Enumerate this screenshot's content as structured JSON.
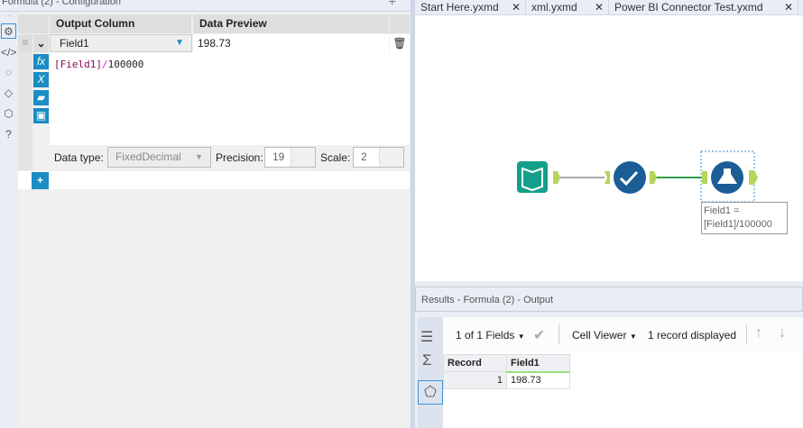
{
  "config": {
    "title": "Formula (2) - Configuration",
    "headers": {
      "output_column": "Output Column",
      "data_preview": "Data Preview"
    },
    "row": {
      "field": "Field1",
      "preview": "198.73"
    },
    "expression": {
      "bracket_open": "[",
      "field": "Field1",
      "bracket_close": "]",
      "op": "/",
      "number": "100000"
    },
    "data_type_label": "Data type:",
    "data_type": "FixedDecimal",
    "precision_label": "Precision:",
    "precision": "19",
    "scale_label": "Scale:",
    "scale": "2"
  },
  "tabs": [
    {
      "label": "Start Here.yxmd"
    },
    {
      "label": "xml.yxmd"
    },
    {
      "label": "Power BI Connector Test.yxmd"
    }
  ],
  "canvas": {
    "annotation_line1": "Field1 =",
    "annotation_line2": "[Field1]/100000"
  },
  "results": {
    "title": "Results - Formula (2) - Output",
    "fields": "1 of 1 Fields",
    "cell_viewer": "Cell Viewer",
    "records": "1 record displayed",
    "columns": [
      "Record",
      "Field1"
    ],
    "rows": [
      [
        "1",
        "198.73"
      ]
    ]
  }
}
